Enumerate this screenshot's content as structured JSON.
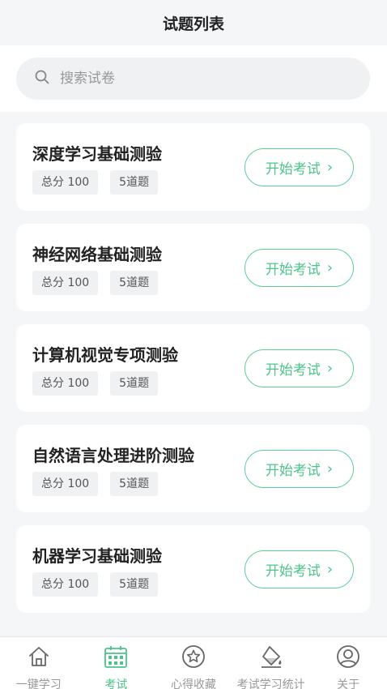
{
  "header": {
    "title": "试题列表"
  },
  "search": {
    "placeholder": "搜索试卷",
    "icon": "search-icon"
  },
  "exams": [
    {
      "name": "深度学习基础测验",
      "score": "总分 100",
      "questions": "5道题",
      "button": "开始考试"
    },
    {
      "name": "神经网络基础测验",
      "score": "总分 100",
      "questions": "5道题",
      "button": "开始考试"
    },
    {
      "name": "计算机视觉专项测验",
      "score": "总分 100",
      "questions": "5道题",
      "button": "开始考试"
    },
    {
      "name": "自然语言处理进阶测验",
      "score": "总分 100",
      "questions": "5道题",
      "button": "开始考试"
    },
    {
      "name": "机器学习基础测验",
      "score": "总分 100",
      "questions": "5道题",
      "button": "开始考试"
    }
  ],
  "tabbar": {
    "items": [
      {
        "label": "一键学习",
        "icon": "home-icon",
        "active": false
      },
      {
        "label": "考试",
        "icon": "calendar-icon",
        "active": true
      },
      {
        "label": "心得收藏",
        "icon": "star-icon",
        "active": false
      },
      {
        "label": "考试学习统计",
        "icon": "paint-bucket-icon",
        "active": false
      },
      {
        "label": "关于",
        "icon": "user-icon",
        "active": false
      }
    ]
  },
  "colors": {
    "accent": "#4cc48a",
    "background": "#f4f6f8",
    "card": "#ffffff",
    "tag_bg": "#f0f1f3"
  }
}
